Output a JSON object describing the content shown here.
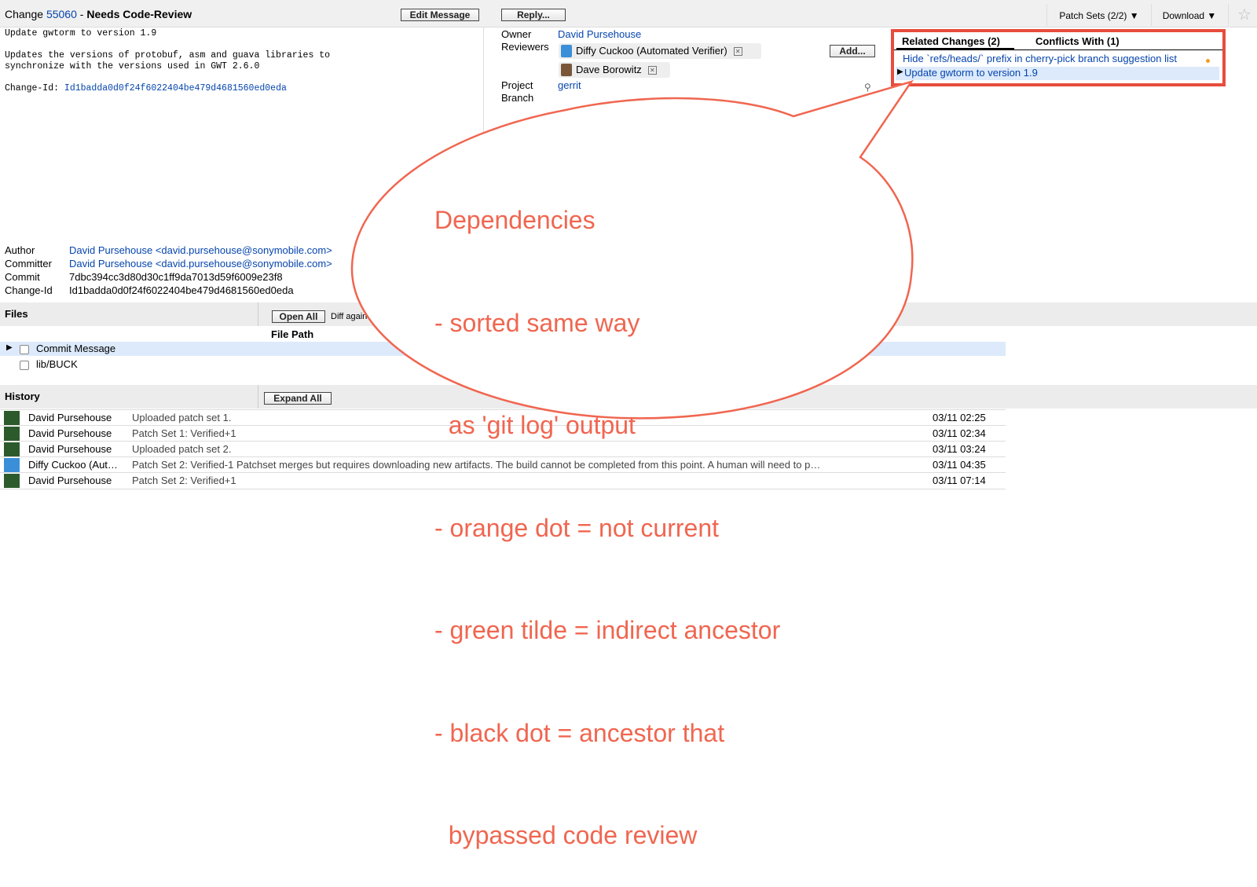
{
  "header": {
    "change_label": "Change",
    "change_number": "55060",
    "separator": "-",
    "status": "Needs Code-Review",
    "edit_message_button": "Edit Message",
    "reply_button": "Reply...",
    "patch_sets_label": "Patch Sets (2/2)",
    "download_label": "Download",
    "star_icon": "star-icon"
  },
  "commit_message": {
    "line1": "Update gwtorm to version 1.9",
    "line2": "Updates the versions of protobuf, asm and guava libraries to",
    "line3": "synchronize with the versions used in GWT 2.6.0",
    "change_id_label": "Change-Id:",
    "change_id_value": "Id1badda0d0f24f6022404be479d4681560ed0eda"
  },
  "info": {
    "owner_label": "Owner",
    "owner_value": "David Pursehouse",
    "reviewers_label": "Reviewers",
    "reviewer1": "Diffy Cuckoo (Automated Verifier)",
    "reviewer2": "Dave Borowitz",
    "add_button": "Add...",
    "project_label": "Project",
    "project_value": "gerrit",
    "branch_label": "Branch"
  },
  "related": {
    "tab1": "Related Changes (2)",
    "tab2": "Conflicts With (1)",
    "item1": "Hide `refs/heads/` prefix in cherry-pick branch suggestion list",
    "item2": "Update gwtorm to version 1.9",
    "orange_dot_color": "#f0a020",
    "highlight_color": "#e74c3c"
  },
  "commit_info": {
    "author_label": "Author",
    "author_value": "David Pursehouse <david.pursehouse@sonymobile.com>",
    "committer_label": "Committer",
    "committer_value": "David Pursehouse <david.pursehouse@sonymobile.com>",
    "commit_label": "Commit",
    "commit_value": "7dbc394cc3d80d30c1ff9da7013d59f6009e23f8",
    "changeid_label": "Change-Id",
    "changeid_value": "Id1badda0d0f24f6022404be479d4681560ed0eda"
  },
  "files": {
    "title": "Files",
    "open_all_button": "Open All",
    "diff_against": "Diff agains",
    "file_path_header": "File Path",
    "rows": [
      "Commit Message",
      "lib/BUCK"
    ]
  },
  "history": {
    "title": "History",
    "expand_all_button": "Expand All",
    "rows": [
      {
        "name": "David Pursehouse",
        "message": "Uploaded patch set 1.",
        "date": "03/11 02:25"
      },
      {
        "name": "David Pursehouse",
        "message": "Patch Set 1: Verified+1",
        "date": "03/11 02:34"
      },
      {
        "name": "David Pursehouse",
        "message": "Uploaded patch set 2.",
        "date": "03/11 03:24"
      },
      {
        "name": "Diffy Cuckoo (Aut…",
        "message": "Patch Set 2: Verified-1 Patchset merges but requires downloading new artifacts. The build cannot be completed from this point. A human will need to p…",
        "date": "03/11 04:35"
      },
      {
        "name": "David Pursehouse",
        "message": "Patch Set 2: Verified+1",
        "date": "03/11 07:14"
      }
    ]
  },
  "callout": {
    "line1": "Dependencies",
    "line2": "- sorted same way",
    "line3": "  as 'git log' output",
    "line4": "- orange dot = not current",
    "line5": "- green tilde = indirect ancestor",
    "line6": "- black dot = ancestor that",
    "line7": "  bypassed code review",
    "color": "#f06650"
  }
}
